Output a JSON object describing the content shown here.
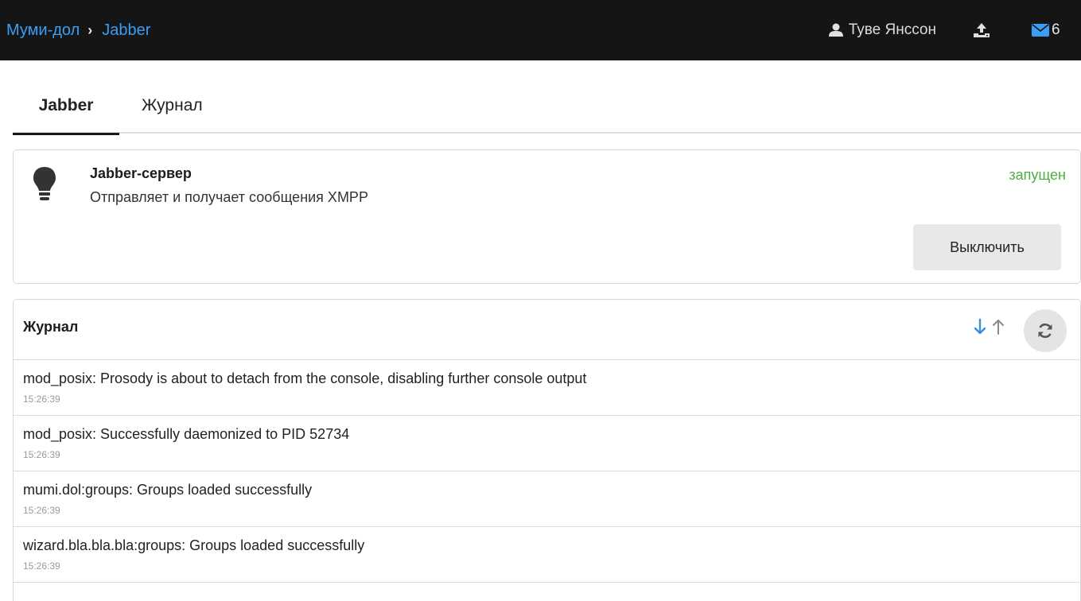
{
  "header": {
    "breadcrumb": [
      {
        "label": "Муми-дол"
      },
      {
        "label": "Jabber"
      }
    ],
    "user_name": "Туве Янссон",
    "mail_count": "6",
    "colors": {
      "bar_bg": "#151515",
      "link": "#3b9ef5"
    }
  },
  "tabs": [
    {
      "label": "Jabber",
      "active": true
    },
    {
      "label": "Журнал",
      "active": false
    }
  ],
  "service": {
    "name": "Jabber-сервер",
    "description": "Отправляет и получает сообщения XMPP",
    "status": "запущен",
    "status_color": "#4caf3f",
    "toggle_label": "Выключить",
    "icon": "lightbulb-icon"
  },
  "log": {
    "title": "Журнал",
    "sort_desc_icon": "arrow-down-icon",
    "sort_asc_icon": "arrow-up-icon",
    "refresh_icon": "refresh-icon",
    "entries": [
      {
        "message": "mod_posix: Prosody is about to detach from the console, disabling further console output",
        "time": "15:26:39"
      },
      {
        "message": "mod_posix: Successfully daemonized to PID 52734",
        "time": "15:26:39"
      },
      {
        "message": "mumi.dol:groups: Groups loaded successfully",
        "time": "15:26:39"
      },
      {
        "message": "wizard.bla.bla.bla:groups: Groups loaded successfully",
        "time": "15:26:39"
      }
    ]
  }
}
